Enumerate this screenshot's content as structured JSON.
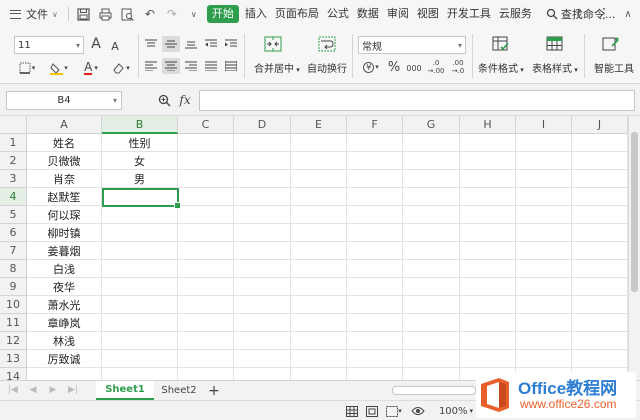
{
  "menubar": {
    "file_label": "文件",
    "tabs": [
      "开始",
      "插入",
      "页面布局",
      "公式",
      "数据",
      "审阅",
      "视图",
      "开发工具",
      "云服务"
    ],
    "active_tab": "开始",
    "search_label": "查找命令...",
    "help_label": "?"
  },
  "ribbon": {
    "font_size": "11",
    "number_format": "常规",
    "merge_label": "合并居中",
    "wrap_label": "自动换行",
    "cond_format_label": "条件格式",
    "table_style_label": "表格样式",
    "smart_label": "智能工具",
    "percent_label": "%",
    "thousands_label": "000",
    "inc_decimal_label": ".00→.0",
    "dec_decimal_label": ".0→.00",
    "font_grow_label": "A",
    "font_shrink_label": "A"
  },
  "formula_bar": {
    "name_box": "B4",
    "fx_label": "fx",
    "value": ""
  },
  "sheet": {
    "columns": [
      "A",
      "B",
      "C",
      "D",
      "E",
      "F",
      "G",
      "H",
      "I",
      "J"
    ],
    "rows": [
      "1",
      "2",
      "3",
      "4",
      "5",
      "6",
      "7",
      "8",
      "9",
      "10",
      "11",
      "12",
      "13",
      "14"
    ],
    "selected_column": "B",
    "selected_row": "4",
    "col_a": [
      "姓名",
      "贝微微",
      "肖奈",
      "赵默笙",
      "何以琛",
      "柳时镇",
      "姜暮烟",
      "白浅",
      "夜华",
      "萧水光",
      "章峥岚",
      "林浅",
      "厉致诚",
      ""
    ],
    "col_b": [
      "性别",
      "女",
      "男",
      "",
      "",
      "",
      "",
      "",
      "",
      "",
      "",
      "",
      "",
      ""
    ]
  },
  "sheet_tabs": [
    "Sheet1",
    "Sheet2"
  ],
  "active_sheet": "Sheet1",
  "add_sheet_label": "+",
  "status": {
    "zoom": "100%",
    "zoom_minus": "−"
  },
  "watermark": {
    "line1": "Office教程网",
    "line2": "www.office26.com"
  },
  "colors": {
    "accent": "#2e9d4e",
    "logo_blue": "#2d7dd2",
    "logo_orange": "#e8612c"
  }
}
